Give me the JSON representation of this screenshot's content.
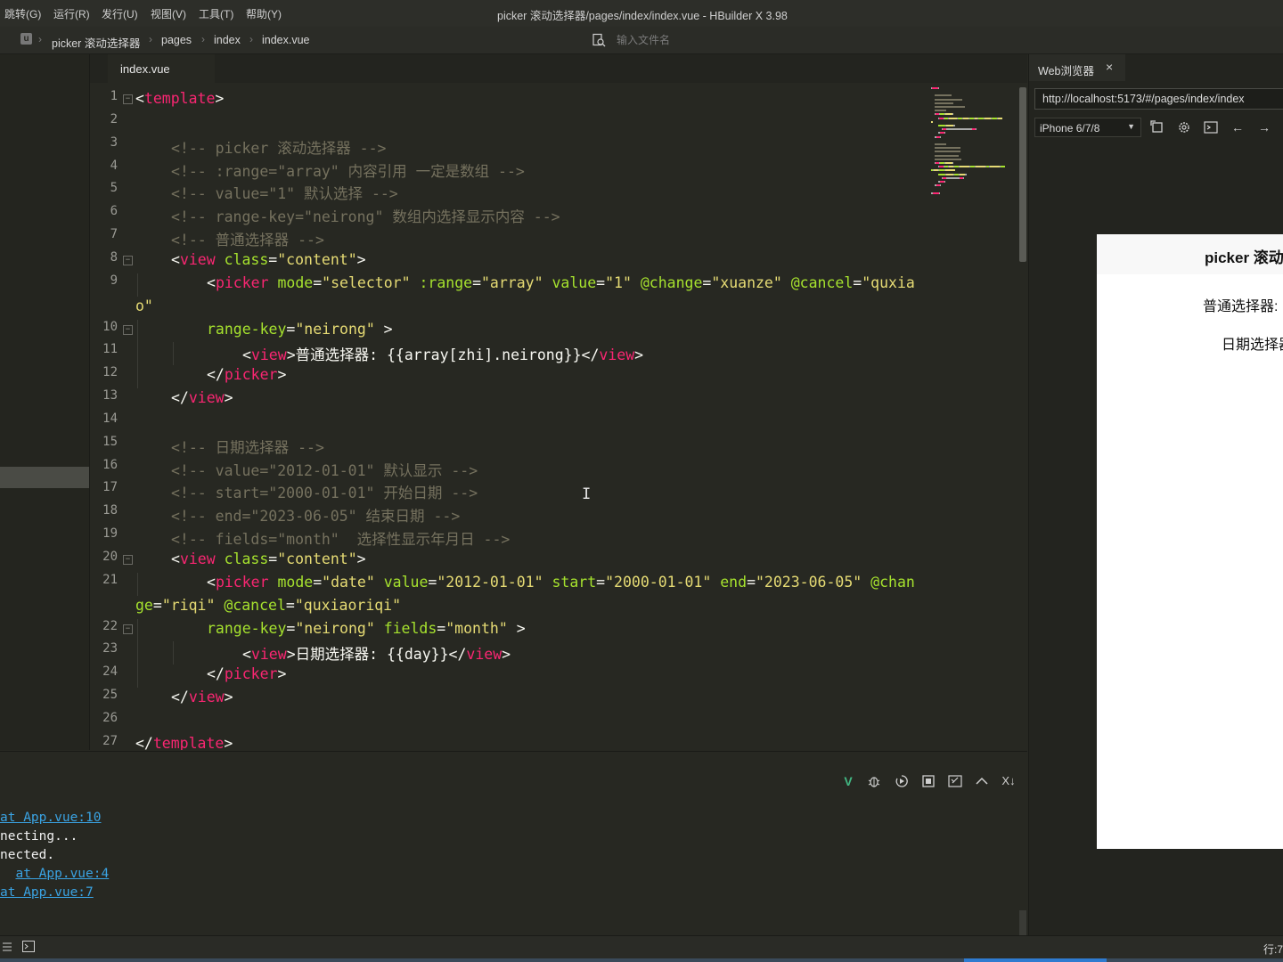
{
  "menubar": {
    "items": [
      "跳转(G)",
      "运行(R)",
      "发行(U)",
      "视图(V)",
      "工具(T)",
      "帮助(Y)"
    ],
    "window_title": "picker 滚动选择器/pages/index/index.vue - HBuilder X 3.98"
  },
  "breadcrumb": {
    "items": [
      "picker 滚动选择器",
      "pages",
      "index",
      "index.vue"
    ],
    "file_search_placeholder": "输入文件名"
  },
  "editor": {
    "active_tab": "index.vue",
    "lines": [
      {
        "num": "1",
        "fold": true,
        "indent": 0,
        "tokens": [
          [
            "pun",
            "<"
          ],
          [
            "tag",
            "template"
          ],
          [
            "pun",
            ">"
          ]
        ]
      },
      {
        "num": "2",
        "fold": false,
        "indent": 0,
        "tokens": []
      },
      {
        "num": "3",
        "fold": false,
        "indent": 1,
        "tokens": [
          [
            "com",
            "<!-- picker 滚动选择器 -->"
          ]
        ]
      },
      {
        "num": "4",
        "fold": false,
        "indent": 1,
        "tokens": [
          [
            "com",
            "<!-- :range=\"array\" 内容引用 一定是数组 -->"
          ]
        ]
      },
      {
        "num": "5",
        "fold": false,
        "indent": 1,
        "tokens": [
          [
            "com",
            "<!-- value=\"1\" 默认选择 -->"
          ]
        ]
      },
      {
        "num": "6",
        "fold": false,
        "indent": 1,
        "tokens": [
          [
            "com",
            "<!-- range-key=\"neirong\" 数组内选择显示内容 -->"
          ]
        ]
      },
      {
        "num": "7",
        "fold": false,
        "indent": 1,
        "tokens": [
          [
            "com",
            "<!-- 普通选择器 -->"
          ]
        ]
      },
      {
        "num": "8",
        "fold": true,
        "indent": 1,
        "tokens": [
          [
            "pun",
            "<"
          ],
          [
            "tag",
            "view"
          ],
          [
            "pun",
            " "
          ],
          [
            "attr",
            "class"
          ],
          [
            "pun",
            "="
          ],
          [
            "str",
            "\"content\""
          ],
          [
            "pun",
            ">"
          ]
        ]
      },
      {
        "num": "9",
        "fold": false,
        "indent": 2,
        "tokens": [
          [
            "pun",
            "<"
          ],
          [
            "tag",
            "picker"
          ],
          [
            "pun",
            " "
          ],
          [
            "attr",
            "mode"
          ],
          [
            "pun",
            "="
          ],
          [
            "str",
            "\"selector\""
          ],
          [
            "pun",
            " "
          ],
          [
            "attr",
            ":range"
          ],
          [
            "pun",
            "="
          ],
          [
            "str",
            "\"array\""
          ],
          [
            "pun",
            " "
          ],
          [
            "attr",
            "value"
          ],
          [
            "pun",
            "="
          ],
          [
            "str",
            "\"1\""
          ],
          [
            "pun",
            " "
          ],
          [
            "attr",
            "@change"
          ],
          [
            "pun",
            "="
          ],
          [
            "str",
            "\"xuanze\""
          ],
          [
            "pun",
            " "
          ],
          [
            "attr",
            "@cancel"
          ],
          [
            "pun",
            "="
          ],
          [
            "str",
            "\"quxia"
          ]
        ]
      },
      {
        "num": "",
        "fold": false,
        "indent": 0,
        "tokens": [
          [
            "str",
            "o\""
          ]
        ]
      },
      {
        "num": "10",
        "fold": true,
        "indent": 2,
        "tokens": [
          [
            "attr",
            "range-key"
          ],
          [
            "pun",
            "="
          ],
          [
            "str",
            "\"neirong\""
          ],
          [
            "pun",
            " >"
          ]
        ]
      },
      {
        "num": "11",
        "fold": false,
        "indent": 3,
        "tokens": [
          [
            "pun",
            "<"
          ],
          [
            "tag",
            "view"
          ],
          [
            "pun",
            ">普通选择器: {{array[zhi].neirong}}</"
          ],
          [
            "tag",
            "view"
          ],
          [
            "pun",
            ">"
          ]
        ]
      },
      {
        "num": "12",
        "fold": false,
        "indent": 2,
        "tokens": [
          [
            "pun",
            "</"
          ],
          [
            "tag",
            "picker"
          ],
          [
            "pun",
            ">"
          ]
        ]
      },
      {
        "num": "13",
        "fold": false,
        "indent": 1,
        "tokens": [
          [
            "pun",
            "</"
          ],
          [
            "tag",
            "view"
          ],
          [
            "pun",
            ">"
          ]
        ]
      },
      {
        "num": "14",
        "fold": false,
        "indent": 0,
        "tokens": []
      },
      {
        "num": "15",
        "fold": false,
        "indent": 1,
        "tokens": [
          [
            "com",
            "<!-- 日期选择器 -->"
          ]
        ]
      },
      {
        "num": "16",
        "fold": false,
        "indent": 1,
        "tokens": [
          [
            "com",
            "<!-- value=\"2012-01-01\" 默认显示 -->"
          ]
        ]
      },
      {
        "num": "17",
        "fold": false,
        "indent": 1,
        "tokens": [
          [
            "com",
            "<!-- start=\"2000-01-01\" 开始日期 -->"
          ]
        ]
      },
      {
        "num": "18",
        "fold": false,
        "indent": 1,
        "tokens": [
          [
            "com",
            "<!-- end=\"2023-06-05\" 结束日期 -->"
          ]
        ]
      },
      {
        "num": "19",
        "fold": false,
        "indent": 1,
        "tokens": [
          [
            "com",
            "<!-- fields=\"month\"  选择性显示年月日 -->"
          ]
        ]
      },
      {
        "num": "20",
        "fold": true,
        "indent": 1,
        "tokens": [
          [
            "pun",
            "<"
          ],
          [
            "tag",
            "view"
          ],
          [
            "pun",
            " "
          ],
          [
            "attr",
            "class"
          ],
          [
            "pun",
            "="
          ],
          [
            "str",
            "\"content\""
          ],
          [
            "pun",
            ">"
          ]
        ]
      },
      {
        "num": "21",
        "fold": false,
        "indent": 2,
        "tokens": [
          [
            "pun",
            "<"
          ],
          [
            "tag",
            "picker"
          ],
          [
            "pun",
            " "
          ],
          [
            "attr",
            "mode"
          ],
          [
            "pun",
            "="
          ],
          [
            "str",
            "\"date\""
          ],
          [
            "pun",
            " "
          ],
          [
            "attr",
            "value"
          ],
          [
            "pun",
            "="
          ],
          [
            "str",
            "\"2012-01-01\""
          ],
          [
            "pun",
            " "
          ],
          [
            "attr",
            "start"
          ],
          [
            "pun",
            "="
          ],
          [
            "str",
            "\"2000-01-01\""
          ],
          [
            "pun",
            " "
          ],
          [
            "attr",
            "end"
          ],
          [
            "pun",
            "="
          ],
          [
            "str",
            "\"2023-06-05\""
          ],
          [
            "pun",
            " "
          ],
          [
            "attr",
            "@chan"
          ]
        ]
      },
      {
        "num": "",
        "fold": false,
        "indent": 0,
        "tokens": [
          [
            "attr",
            "ge"
          ],
          [
            "pun",
            "="
          ],
          [
            "str",
            "\"riqi\""
          ],
          [
            "pun",
            " "
          ],
          [
            "attr",
            "@cancel"
          ],
          [
            "pun",
            "="
          ],
          [
            "str",
            "\"quxiaoriqi\""
          ]
        ]
      },
      {
        "num": "22",
        "fold": true,
        "indent": 2,
        "tokens": [
          [
            "attr",
            "range-key"
          ],
          [
            "pun",
            "="
          ],
          [
            "str",
            "\"neirong\""
          ],
          [
            "pun",
            " "
          ],
          [
            "attr",
            "fields"
          ],
          [
            "pun",
            "="
          ],
          [
            "str",
            "\"month\""
          ],
          [
            "pun",
            " >"
          ]
        ]
      },
      {
        "num": "23",
        "fold": false,
        "indent": 3,
        "tokens": [
          [
            "pun",
            "<"
          ],
          [
            "tag",
            "view"
          ],
          [
            "pun",
            ">日期选择器: {{day}}</"
          ],
          [
            "tag",
            "view"
          ],
          [
            "pun",
            ">"
          ]
        ]
      },
      {
        "num": "24",
        "fold": false,
        "indent": 2,
        "tokens": [
          [
            "pun",
            "</"
          ],
          [
            "tag",
            "picker"
          ],
          [
            "pun",
            ">"
          ]
        ]
      },
      {
        "num": "25",
        "fold": false,
        "indent": 1,
        "tokens": [
          [
            "pun",
            "</"
          ],
          [
            "tag",
            "view"
          ],
          [
            "pun",
            ">"
          ]
        ]
      },
      {
        "num": "26",
        "fold": false,
        "indent": 0,
        "tokens": []
      },
      {
        "num": "27",
        "fold": false,
        "indent": 0,
        "tokens": [
          [
            "pun",
            "</"
          ],
          [
            "tag",
            "template"
          ],
          [
            "pun",
            ">"
          ]
        ]
      }
    ]
  },
  "console": {
    "tools": [
      "vue-icon",
      "debug-icon",
      "restart-icon",
      "stop-icon",
      "clear-icon",
      "collapse-up-icon",
      "clear-filter-icon"
    ],
    "lines": [
      {
        "text": "at App.vue:10",
        "link": true,
        "indent": ""
      },
      {
        "text": "necting...",
        "link": false,
        "indent": ""
      },
      {
        "text": "nected.",
        "link": false,
        "indent": ""
      },
      {
        "text": "at App.vue:4",
        "link": true,
        "indent": "  "
      },
      {
        "text": "at App.vue:7",
        "link": true,
        "indent": ""
      }
    ]
  },
  "statusbar": {
    "position": "行:7"
  },
  "web": {
    "tab_label": "Web浏览器",
    "url": "http://localhost:5173/#/pages/index/index",
    "device": "iPhone 6/7/8",
    "nav_title": "picker 滚动选择器",
    "picker1": "普通选择器:",
    "picker2": "日期选择器"
  },
  "colors": {
    "background": "#272822",
    "comment": "#75715e",
    "tag": "#f92672",
    "attribute": "#a6e22e",
    "string": "#e6db74",
    "link": "#3aa3e3"
  }
}
